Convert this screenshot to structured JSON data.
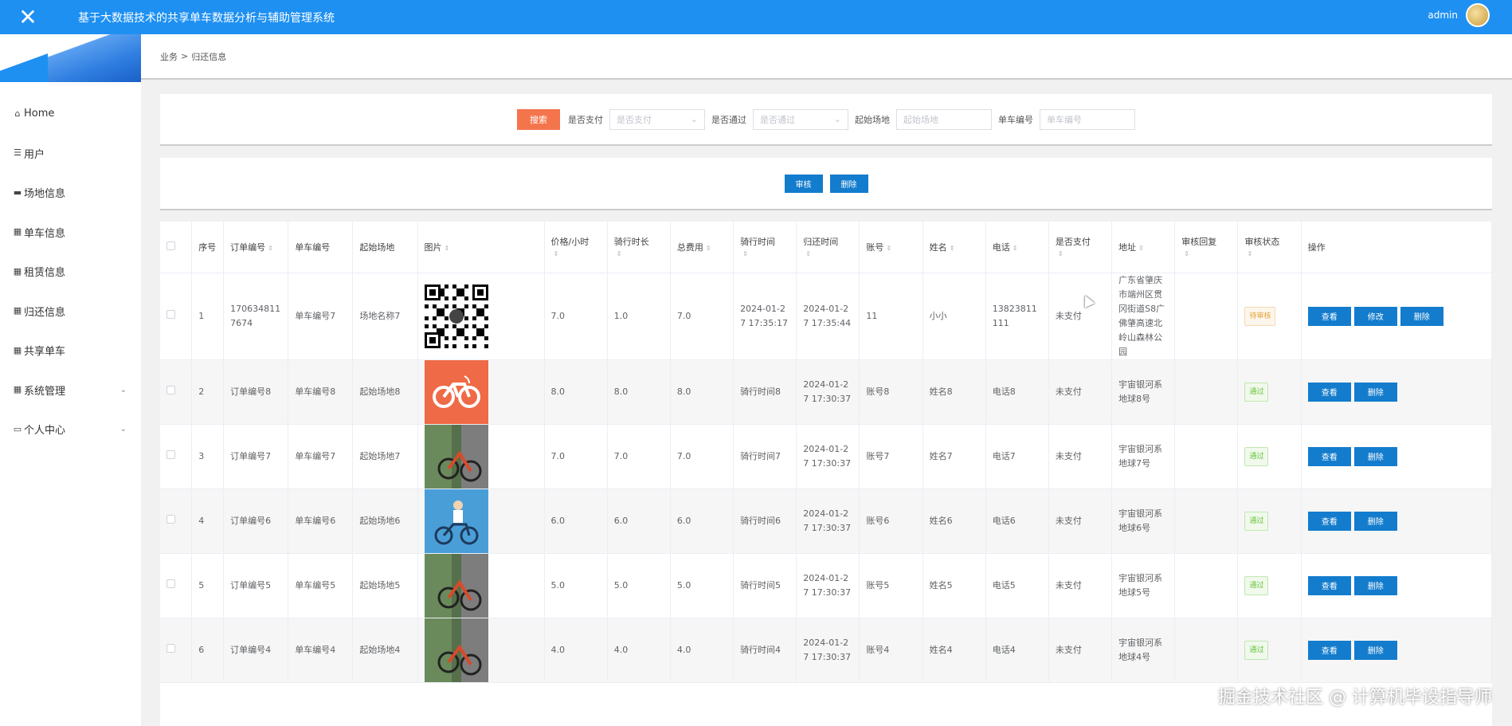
{
  "header": {
    "close_icon": "close-icon",
    "title": "基于大数据技术的共享单车数据分析与辅助管理系统",
    "username": "admin"
  },
  "sidebar": {
    "items": [
      {
        "label": "Home",
        "icon": "home-icon"
      },
      {
        "label": "用户",
        "icon": "sliders-icon"
      },
      {
        "label": "场地信息",
        "icon": "ticket-icon"
      },
      {
        "label": "单车信息",
        "icon": "grid-icon"
      },
      {
        "label": "租赁信息",
        "icon": "grid-icon"
      },
      {
        "label": "归还信息",
        "icon": "grid-icon"
      },
      {
        "label": "共享单车",
        "icon": "grid-icon"
      },
      {
        "label": "系统管理",
        "icon": "grid-icon",
        "has_children": true
      },
      {
        "label": "个人中心",
        "icon": "folder-icon",
        "has_children": true
      }
    ]
  },
  "breadcrumb": {
    "root": "业务",
    "separator": ">",
    "current": "归还信息"
  },
  "search": {
    "button": "搜索",
    "paid_label": "是否支付",
    "paid_placeholder": "是否支付",
    "pass_label": "是否通过",
    "pass_placeholder": "是否通过",
    "site_label": "起始场地",
    "site_placeholder": "起始场地",
    "bike_label": "单车编号",
    "bike_placeholder": "单车编号"
  },
  "actions": {
    "audit": "审核",
    "delete": "删除"
  },
  "table": {
    "columns": [
      "序号",
      "订单编号",
      "单车编号",
      "起始场地",
      "图片",
      "价格/小时",
      "骑行时长",
      "总费用",
      "骑行时间",
      "归还时间",
      "账号",
      "姓名",
      "电话",
      "是否支付",
      "地址",
      "审核回复",
      "审核状态",
      "操作"
    ],
    "rows": [
      {
        "no": "1",
        "order": "1706348117674",
        "bike": "单车编号7",
        "site": "场地名称7",
        "image": "qr-code",
        "price": "7.0",
        "duration": "1.0",
        "total": "7.0",
        "ride_time": "2024-01-27 17:35:17",
        "return_time": "2024-01-27 17:35:44",
        "account": "11",
        "name": "小小",
        "phone": "13823811111",
        "paid": "未支付",
        "address": "广东省肇庆市端州区贯冈街道S8广佛肇高速北岭山森林公园",
        "reply": "",
        "status": "待审核",
        "status_type": "wait",
        "ops": [
          "查看",
          "修改",
          "删除"
        ]
      },
      {
        "no": "2",
        "order": "订单编号8",
        "bike": "单车编号8",
        "site": "起始场地8",
        "image": "bike-logo",
        "price": "8.0",
        "duration": "8.0",
        "total": "8.0",
        "ride_time": "骑行时间8",
        "return_time": "2024-01-27 17:30:37",
        "account": "账号8",
        "name": "姓名8",
        "phone": "电话8",
        "paid": "未支付",
        "address": "宇宙银河系地球8号",
        "reply": "",
        "status": "通过",
        "status_type": "pass",
        "ops": [
          "查看",
          "删除"
        ]
      },
      {
        "no": "3",
        "order": "订单编号7",
        "bike": "单车编号7",
        "site": "起始场地7",
        "image": "bike-photo",
        "price": "7.0",
        "duration": "7.0",
        "total": "7.0",
        "ride_time": "骑行时间7",
        "return_time": "2024-01-27 17:30:37",
        "account": "账号7",
        "name": "姓名7",
        "phone": "电话7",
        "paid": "未支付",
        "address": "宇宙银河系地球7号",
        "reply": "",
        "status": "通过",
        "status_type": "pass",
        "ops": [
          "查看",
          "删除"
        ]
      },
      {
        "no": "4",
        "order": "订单编号6",
        "bike": "单车编号6",
        "site": "起始场地6",
        "image": "rider-illustration",
        "price": "6.0",
        "duration": "6.0",
        "total": "6.0",
        "ride_time": "骑行时间6",
        "return_time": "2024-01-27 17:30:37",
        "account": "账号6",
        "name": "姓名6",
        "phone": "电话6",
        "paid": "未支付",
        "address": "宇宙银河系地球6号",
        "reply": "",
        "status": "通过",
        "status_type": "pass",
        "ops": [
          "查看",
          "删除"
        ]
      },
      {
        "no": "5",
        "order": "订单编号5",
        "bike": "单车编号5",
        "site": "起始场地5",
        "image": "bike-photo",
        "price": "5.0",
        "duration": "5.0",
        "total": "5.0",
        "ride_time": "骑行时间5",
        "return_time": "2024-01-27 17:30:37",
        "account": "账号5",
        "name": "姓名5",
        "phone": "电话5",
        "paid": "未支付",
        "address": "宇宙银河系地球5号",
        "reply": "",
        "status": "通过",
        "status_type": "pass",
        "ops": [
          "查看",
          "删除"
        ]
      },
      {
        "no": "6",
        "order": "订单编号4",
        "bike": "单车编号4",
        "site": "起始场地4",
        "image": "bike-photo",
        "price": "4.0",
        "duration": "4.0",
        "total": "4.0",
        "ride_time": "骑行时间4",
        "return_time": "2024-01-27 17:30:37",
        "account": "账号4",
        "name": "姓名4",
        "phone": "电话4",
        "paid": "未支付",
        "address": "宇宙银河系地球4号",
        "reply": "",
        "status": "通过",
        "status_type": "pass",
        "ops": [
          "查看",
          "删除"
        ]
      }
    ]
  },
  "watermark": "掘金技术社区 @ 计算机毕设指导师",
  "colors": {
    "primary": "#1e90f2",
    "button": "#137ccd",
    "search_button": "#f4744c",
    "pass": "#67c23a",
    "wait": "#e6a23c"
  }
}
